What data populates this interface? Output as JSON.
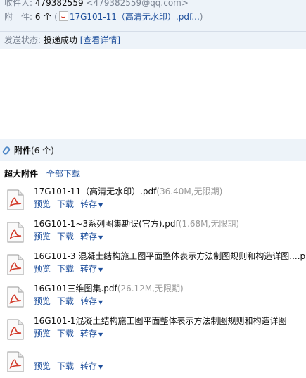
{
  "header": {
    "to_label": "收件人:",
    "to_value": "479382559",
    "to_email": "<479382559@qq.com>",
    "attach_label": "附　件:",
    "attach_count": "6 个",
    "attach_paren_open": "(",
    "attach_first": "17G101-11（高清无水印）.pdf...",
    "attach_paren_close": ")",
    "status_label": "发送状态:",
    "status_value": "投递成功",
    "status_details": "[查看详情]"
  },
  "attachments_header": {
    "title": "附件",
    "count": "(6 个)"
  },
  "subheader": {
    "label": "超大附件",
    "download_all": "全部下载"
  },
  "actions": {
    "preview": "预览",
    "download": "下载",
    "forward": "转存"
  },
  "files": [
    {
      "name": "17G101-11（高清无水印）.pdf",
      "meta": "(36.40M,无限期)"
    },
    {
      "name": "16G101-1~3系列图集勘误(官方).pdf",
      "meta": "(1.68M,无限期)"
    },
    {
      "name": "16G101-3 混凝土结构施工图平面整体表示方法制图规则和构造详图....p",
      "meta": ""
    },
    {
      "name": "16G101三维图集.pdf",
      "meta": "(26.12M,无限期)"
    },
    {
      "name": "16G101-1混凝土结构施工图平面整体表示方法制图规则和构造详图",
      "meta": ""
    },
    {
      "name": "",
      "meta": ""
    }
  ],
  "icons": {
    "attachment": "paperclip-icon",
    "file": "pdf-file-icon",
    "dropdown": "chevron-down-icon"
  },
  "colors": {
    "header_bg": "#edf3f9",
    "link": "#1e4f9c",
    "pdf_accent": "#d23a2a"
  }
}
